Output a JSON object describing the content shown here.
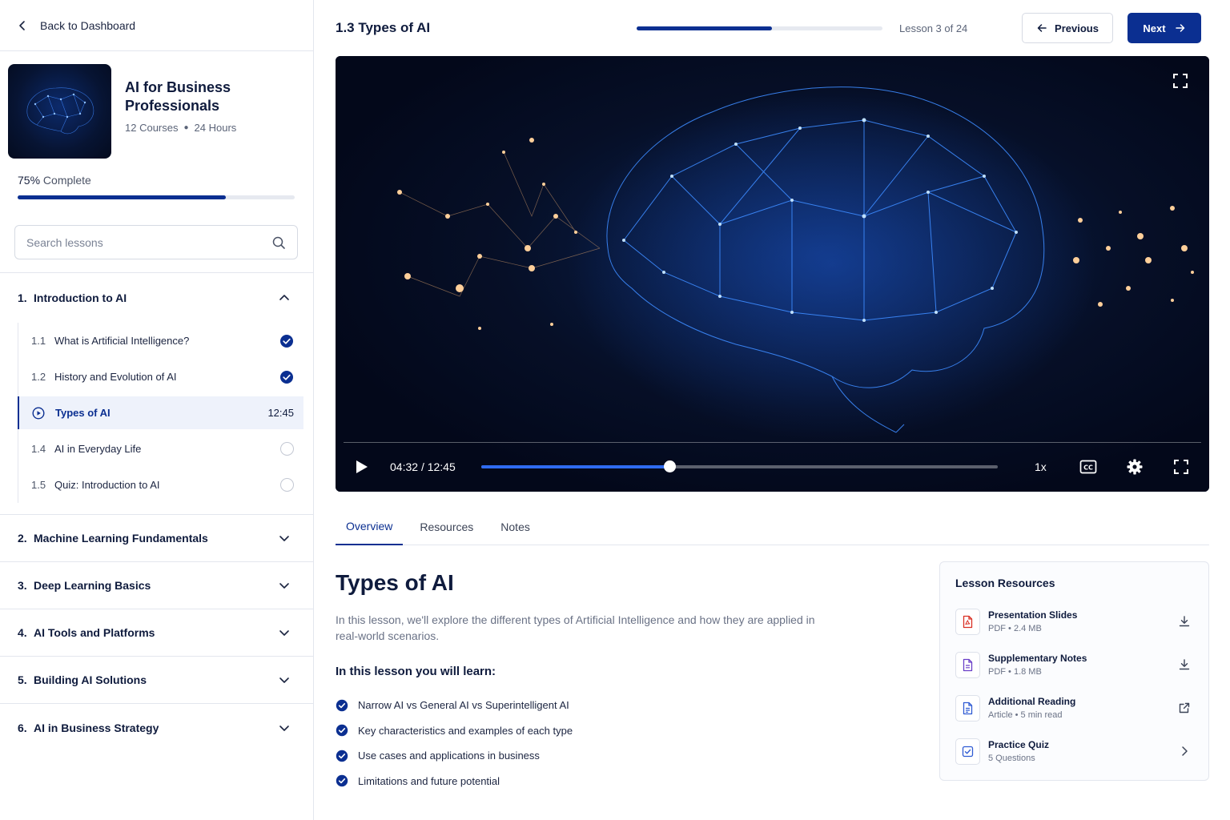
{
  "sidebar": {
    "back_label": "Back to Dashboard",
    "course": {
      "title": "AI for Business Professionals",
      "courses": "12 Courses",
      "hours": "24 Hours"
    },
    "progress": {
      "percent_text": "75%",
      "suffix": " Complete",
      "fraction": 0.75
    },
    "search": {
      "placeholder": "Search lessons",
      "value": ""
    },
    "modules": [
      {
        "num": "1.",
        "title": "Introduction to AI",
        "expanded": true,
        "lessons": [
          {
            "num": "1.1",
            "title": "What is Artificial Intelligence?",
            "status": "complete"
          },
          {
            "num": "1.2",
            "title": "History and Evolution of AI",
            "status": "complete"
          },
          {
            "num": "",
            "title": "Types of AI",
            "status": "current",
            "duration": "12:45"
          },
          {
            "num": "1.4",
            "title": "AI in Everyday Life",
            "status": "incomplete"
          },
          {
            "num": "1.5",
            "title": "Quiz: Introduction to AI",
            "status": "incomplete"
          }
        ]
      },
      {
        "num": "2.",
        "title": "Machine Learning Fundamentals"
      },
      {
        "num": "3.",
        "title": "Deep Learning Basics"
      },
      {
        "num": "4.",
        "title": "AI Tools and Platforms"
      },
      {
        "num": "5.",
        "title": "Building AI Solutions"
      },
      {
        "num": "6.",
        "title": "AI in Business Strategy"
      }
    ]
  },
  "header": {
    "lesson_title": "1.3 Types of AI",
    "lesson_progress_fraction": 0.55,
    "lesson_counter": "Lesson 3 of 24",
    "prev_label": "Previous",
    "next_label": "Next"
  },
  "player": {
    "current_time": "04:32",
    "separator": "/",
    "duration": "12:45",
    "played_fraction": 0.365,
    "buffered_fraction": 0.13,
    "speed": "1x",
    "cc_label": "CC"
  },
  "tabs": [
    {
      "label": "Overview",
      "active": true
    },
    {
      "label": "Resources",
      "active": false
    },
    {
      "label": "Notes",
      "active": false
    }
  ],
  "overview": {
    "title": "Types of AI",
    "description": "In this lesson, we'll explore the different types of Artificial Intelligence and how they are applied in real-world scenarios.",
    "learn_heading": "In this lesson you will learn:",
    "learn_items": [
      "Narrow AI vs General AI vs Superintelligent AI",
      "Key characteristics and examples of each type",
      "Use cases and applications in business",
      "Limitations and future potential"
    ]
  },
  "resources": {
    "title": "Lesson Resources",
    "items": [
      {
        "name": "Presentation Slides",
        "meta": "PDF • 2.4 MB",
        "icon": "pdf-file-icon",
        "action": "download-icon"
      },
      {
        "name": "Supplementary Notes",
        "meta": "PDF • 1.8 MB",
        "icon": "notes-file-icon",
        "action": "download-icon"
      },
      {
        "name": "Additional Reading",
        "meta": "Article • 5 min read",
        "icon": "article-icon",
        "action": "external-link-icon"
      },
      {
        "name": "Practice Quiz",
        "meta": "5 Questions",
        "icon": "quiz-icon",
        "action": "chevron-right-icon"
      }
    ]
  },
  "colors": {
    "primary": "#0b2f91",
    "scrub": "#2f6bf0",
    "pdf": "#d93025",
    "notes": "#6a3fc8",
    "article": "#2f5bd3"
  }
}
